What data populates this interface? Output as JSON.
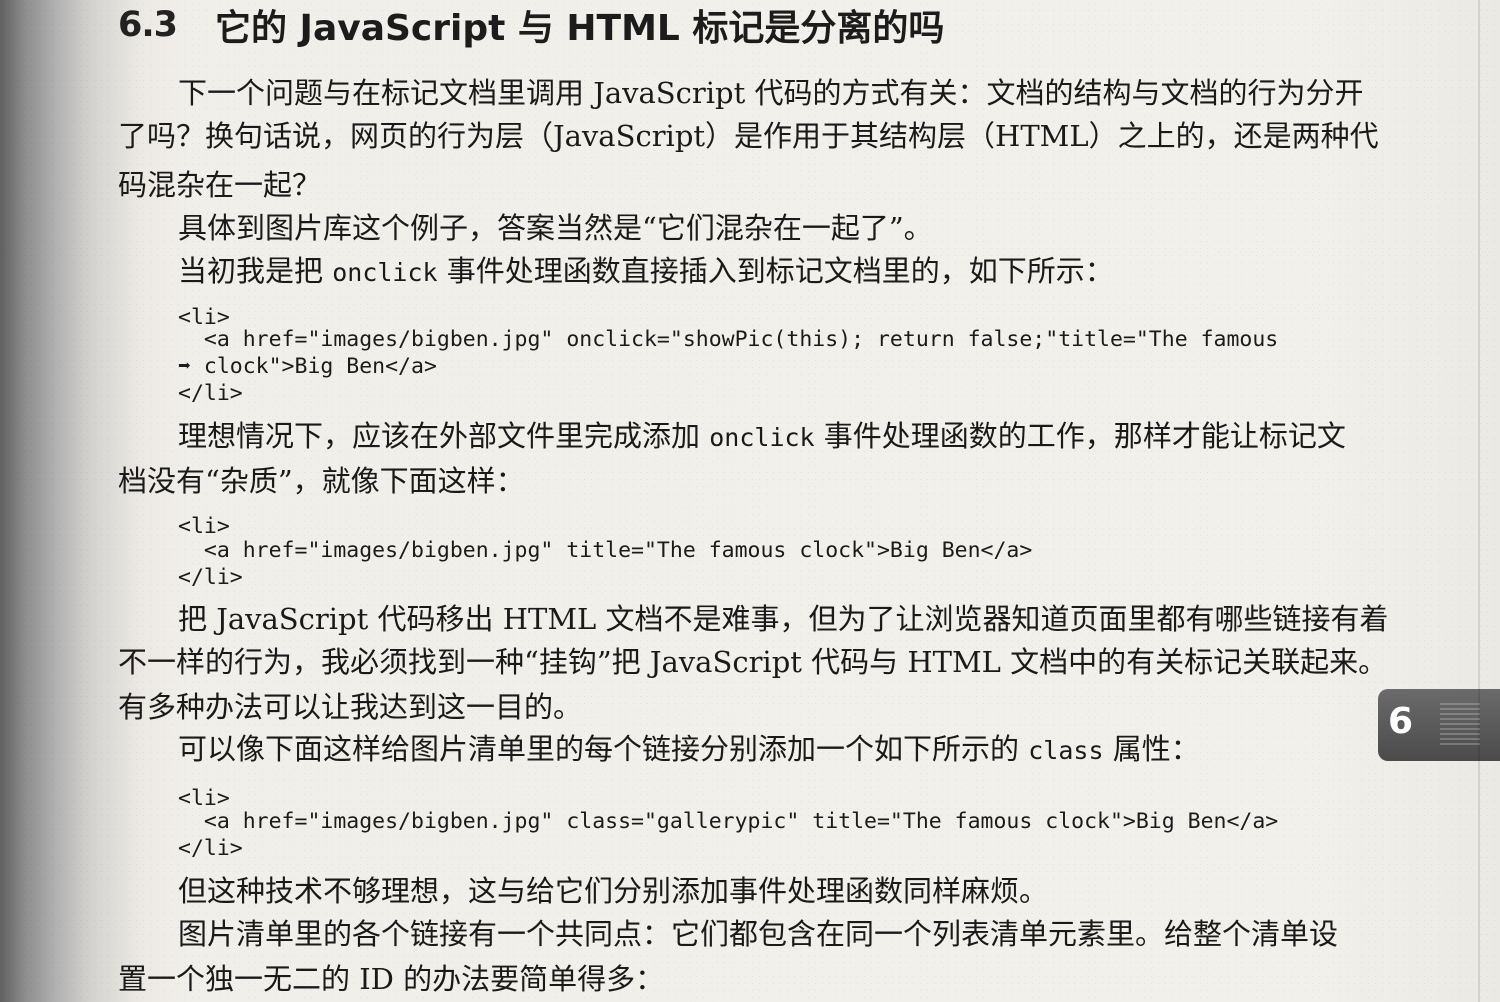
{
  "section": {
    "number": "6.3",
    "title": "它的 JavaScript 与 HTML 标记是分离的吗"
  },
  "paragraphs": {
    "p1_l1": "下一个问题与在标记文档里调用 JavaScript 代码的方式有关：文档的结构与文档的行为分开",
    "p1_l2": "了吗？换句话说，网页的行为层（JavaScript）是作用于其结构层（HTML）之上的，还是两种代",
    "p1_l3": "码混杂在一起？",
    "p2": "具体到图片库这个例子，答案当然是“它们混杂在一起了”。",
    "p3_pre": "当初我是把 ",
    "p3_code": "onclick",
    "p3_post": " 事件处理函数直接插入到标记文档里的，如下所示：",
    "p4_l1_pre": "理想情况下，应该在外部文件里完成添加 ",
    "p4_l1_code": "onclick",
    "p4_l1_post": " 事件处理函数的工作，那样才能让标记文",
    "p4_l2": "档没有“杂质”，就像下面这样：",
    "p5_l1": "把 JavaScript 代码移出 HTML 文档不是难事，但为了让浏览器知道页面里都有哪些链接有着",
    "p5_l2": "不一样的行为，我必须找到一种“挂钩”把 JavaScript 代码与 HTML 文档中的有关标记关联起来。",
    "p5_l3": "有多种办法可以让我达到这一目的。",
    "p6_pre": "可以像下面这样给图片清单里的每个链接分别添加一个如下所示的 ",
    "p6_code": "class",
    "p6_post": " 属性：",
    "p7": "但这种技术不够理想，这与给它们分别添加事件处理函数同样麻烦。",
    "p8_l1": "图片清单里的各个链接有一个共同点：它们都包含在同一个列表清单元素里。给整个清单设",
    "p8_l2": "置一个独一无二的 ID 的办法要简单得多："
  },
  "code1": {
    "l1": "<li>",
    "l2": "  <a href=\"images/bigben.jpg\" onclick=\"showPic(this); return false;\"title=\"The famous",
    "l3": "➡ clock\">Big Ben</a>",
    "l4": "</li>"
  },
  "code2": {
    "l1": "<li>",
    "l2": "  <a href=\"images/bigben.jpg\" title=\"The famous clock\">Big Ben</a>",
    "l3": "</li>"
  },
  "code3": {
    "l1": "<li>",
    "l2": "  <a href=\"images/bigben.jpg\" class=\"gallerypic\" title=\"The famous clock\">Big Ben</a>",
    "l3": "</li>"
  },
  "chapter_tab": {
    "label": "6"
  }
}
